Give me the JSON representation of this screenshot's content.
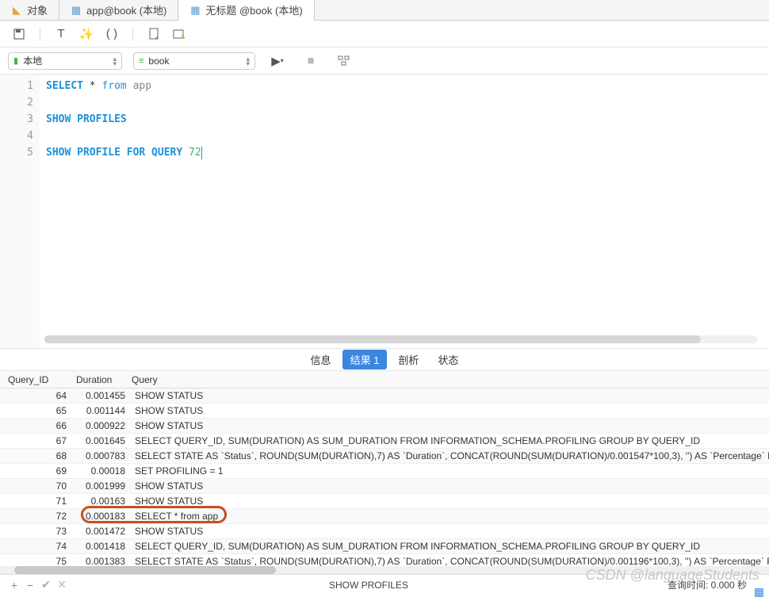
{
  "tabs": [
    {
      "label": "对象"
    },
    {
      "label": "app@book (本地)"
    },
    {
      "label": "无标题 @book (本地)"
    }
  ],
  "selectors": {
    "connection": "本地",
    "database": "book"
  },
  "editor": {
    "lines": [
      "1",
      "2",
      "3",
      "4",
      "5"
    ],
    "l1_kw": "SELECT",
    "l1_star": " * ",
    "l1_from": "from",
    "l1_id": " app",
    "l3_kw": "SHOW PROFILES",
    "l5_a": "SHOW PROFILE FOR QUERY ",
    "l5_num": "72"
  },
  "result_tabs": {
    "info": "信息",
    "result": "结果 1",
    "analyze": "剖析",
    "status": "状态"
  },
  "columns": {
    "c1": "Query_ID",
    "c2": "Duration",
    "c3": "Query"
  },
  "rows": [
    {
      "id": "64",
      "dur": "0.001455",
      "q": "SHOW STATUS"
    },
    {
      "id": "65",
      "dur": "0.001144",
      "q": "SHOW STATUS"
    },
    {
      "id": "66",
      "dur": "0.000922",
      "q": "SHOW STATUS"
    },
    {
      "id": "67",
      "dur": "0.001645",
      "q": "SELECT QUERY_ID, SUM(DURATION) AS SUM_DURATION FROM INFORMATION_SCHEMA.PROFILING GROUP BY QUERY_ID"
    },
    {
      "id": "68",
      "dur": "0.000783",
      "q": "SELECT STATE AS `Status`, ROUND(SUM(DURATION),7) AS `Duration`, CONCAT(ROUND(SUM(DURATION)/0.001547*100,3), '') AS `Percentage` FROM"
    },
    {
      "id": "69",
      "dur": "0.00018",
      "q": "SET PROFILING = 1"
    },
    {
      "id": "70",
      "dur": "0.001999",
      "q": "SHOW STATUS"
    },
    {
      "id": "71",
      "dur": "0.00163",
      "q": "SHOW STATUS"
    },
    {
      "id": "72",
      "dur": "0.000183",
      "q": "SELECT * from app"
    },
    {
      "id": "73",
      "dur": "0.001472",
      "q": "SHOW STATUS"
    },
    {
      "id": "74",
      "dur": "0.001418",
      "q": "SELECT QUERY_ID, SUM(DURATION) AS SUM_DURATION FROM INFORMATION_SCHEMA.PROFILING GROUP BY QUERY_ID"
    },
    {
      "id": "75",
      "dur": "0.001383",
      "q": "SELECT STATE AS `Status`, ROUND(SUM(DURATION),7) AS `Duration`, CONCAT(ROUND(SUM(DURATION)/0.001196*100,3), '') AS `Percentage` FROM"
    }
  ],
  "footer": {
    "center": "SHOW PROFILES",
    "right": "查询时间: 0.000 秒"
  },
  "watermark": "CSDN @languageStudents"
}
